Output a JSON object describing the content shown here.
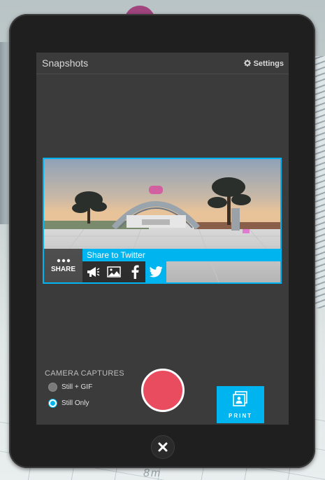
{
  "screen": {
    "title": "Snapshots",
    "settings_label": "Settings",
    "settings_icon": "gear-icon"
  },
  "snapshot": {
    "share_toggle_label": "SHARE",
    "share_bar_label": "Share to Twitter",
    "share_icons": [
      "megaphone-icon",
      "image-icon",
      "facebook-icon",
      "twitter-icon"
    ]
  },
  "captures": {
    "label": "CAMERA CAPTURES",
    "options": [
      {
        "label": "Still + GIF",
        "selected": false
      },
      {
        "label": "Still Only",
        "selected": true
      }
    ]
  },
  "print": {
    "label": "PRINT",
    "icon": "print-photo-icon"
  },
  "close": {
    "icon": "close-icon"
  },
  "world": {
    "floor_text": "8m"
  },
  "colors": {
    "accent": "#00b4ef",
    "capture": "#ea4c5f",
    "screen_bg": "#3b3b3b",
    "tablet_bezel": "#1f1f1f"
  }
}
